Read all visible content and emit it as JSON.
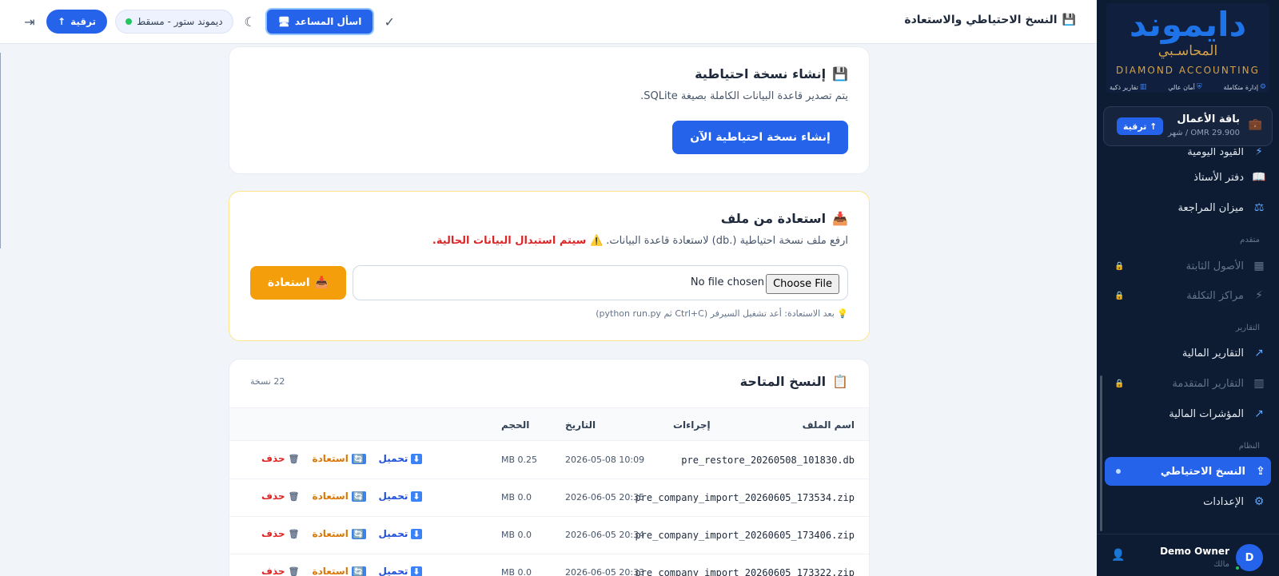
{
  "header": {
    "title": "النسخ الاحتياطي والاستعادة",
    "assistant_label": "اسأل المساعد",
    "store_label": "ديموند ستور - مسقط",
    "upgrade_label": "ترقية"
  },
  "brand": {
    "name_ar": "دايموند",
    "sub_ar": "المحاسـبي",
    "name_en": "DIAMOND ACCOUNTING",
    "features": [
      "إدارة متكاملة",
      "أمان عالي",
      "تقارير ذكية"
    ]
  },
  "plan": {
    "name": "باقة الأعمال",
    "price": "OMR 29.900 / شهر",
    "upgrade_label": "↑ ترقية"
  },
  "sidebar": {
    "partial_item": "القيود اليومية",
    "items": [
      {
        "label": "دفتر الأستاذ",
        "icon": "book-icon"
      },
      {
        "label": "ميزان المراجعة",
        "icon": "scale-icon"
      }
    ],
    "section_advanced": "متقدم",
    "advanced_items": [
      {
        "label": "الأصول الثابتة",
        "icon": "building-icon",
        "locked": true
      },
      {
        "label": "مراكز التكلفة",
        "icon": "bolt-icon",
        "locked": true
      }
    ],
    "section_reports": "التقارير",
    "report_items": [
      {
        "label": "التقارير المالية",
        "icon": "trend-icon"
      },
      {
        "label": "التقارير المتقدمة",
        "icon": "bar-chart-icon",
        "locked": true
      },
      {
        "label": "المؤشرات المالية",
        "icon": "trend-icon"
      }
    ],
    "section_system": "النظام",
    "system_items": [
      {
        "label": "النسخ الاحتياطي",
        "icon": "cloud-upload-icon",
        "active": true
      },
      {
        "label": "الإعدادات",
        "icon": "gear-icon"
      }
    ]
  },
  "user": {
    "initial": "D",
    "name": "Demo Owner",
    "role": "مالك"
  },
  "backup_card": {
    "title": "إنشاء نسخة احتياطية",
    "description": "يتم تصدير قاعدة البيانات الكاملة بصيغة SQLite.",
    "button_label": "إنشاء نسخة احتياطية الآن"
  },
  "restore_card": {
    "title": "استعادة من ملف",
    "description": "ارفع ملف نسخة احتياطية (.db) لاستعادة قاعدة البيانات.",
    "warning": "⚠️ سيتم استبدال البيانات الحالية.",
    "file_button": "Choose File",
    "file_status": "No file chosen",
    "restore_label": "استعادة",
    "hint": "💡 بعد الاستعادة: أعد تشغيل السيرفر (Ctrl+C ثم python run.py)"
  },
  "backups": {
    "title": "النسخ المتاحة",
    "count": "22 نسخة",
    "columns": {
      "file": "اسم الملف",
      "size": "الحجم",
      "date": "التاريخ",
      "actions": "إجراءات"
    },
    "action_labels": {
      "download": "تحميل",
      "restore": "استعادة",
      "delete": "حذف"
    },
    "rows": [
      {
        "file": "pre_restore_20260508_101830.db",
        "size": "0.25 MB",
        "date": "2026-05-08 10:09"
      },
      {
        "file": "pre_company_import_20260605_173534.zip",
        "size": "0.0 MB",
        "date": "2026-06-05 20:35"
      },
      {
        "file": "pre_company_import_20260605_173406.zip",
        "size": "0.0 MB",
        "date": "2026-06-05 20:34"
      },
      {
        "file": "pre_company_import_20260605_173322.zip",
        "size": "0.0 MB",
        "date": "2026-06-05 20:33"
      }
    ]
  },
  "colors": {
    "accent": "#2563eb",
    "sidebar_bg": "#0d1c33",
    "warning": "#f59e0b",
    "danger": "#dc2626"
  }
}
